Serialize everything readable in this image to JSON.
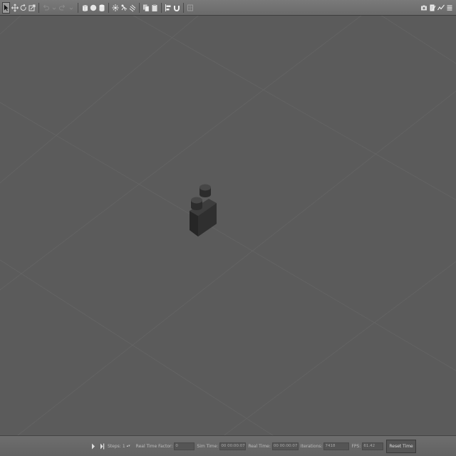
{
  "toolbar": {
    "left_tools": [
      {
        "icon": "select-arrow-icon"
      },
      {
        "icon": "translate-icon"
      },
      {
        "icon": "rotate-icon"
      },
      {
        "icon": "scale-icon"
      },
      {
        "icon": "undo-icon"
      },
      {
        "icon": "undo-dropdown-icon"
      },
      {
        "icon": "redo-icon"
      },
      {
        "icon": "redo-dropdown-icon"
      },
      {
        "icon": "box-shape-icon"
      },
      {
        "icon": "sphere-shape-icon"
      },
      {
        "icon": "cylinder-shape-icon"
      },
      {
        "icon": "point-light-icon"
      },
      {
        "icon": "spot-light-icon"
      },
      {
        "icon": "directional-light-icon"
      },
      {
        "icon": "copy-icon"
      },
      {
        "icon": "paste-icon"
      },
      {
        "icon": "align-icon"
      },
      {
        "icon": "snap-icon"
      },
      {
        "icon": "change-view-icon"
      }
    ],
    "right_tools": [
      {
        "icon": "screenshot-icon"
      },
      {
        "icon": "log-icon"
      },
      {
        "icon": "plot-icon"
      },
      {
        "icon": "record-video-icon"
      }
    ]
  },
  "bottom_bar": {
    "steps_label": "Steps:",
    "steps_value": "1",
    "real_time_factor_label": "Real Time Factor:",
    "real_time_factor_value": "0",
    "sim_time_label": "Sim Time:",
    "sim_time_value": "00 00:00:07.418",
    "real_time_label": "Real Time:",
    "real_time_value": "00 00:00:07.462",
    "iterations_label": "Iterations:",
    "iterations_value": "7418",
    "fps_label": "FPS:",
    "fps_value": "61.42",
    "reset_button": "Reset Time"
  }
}
